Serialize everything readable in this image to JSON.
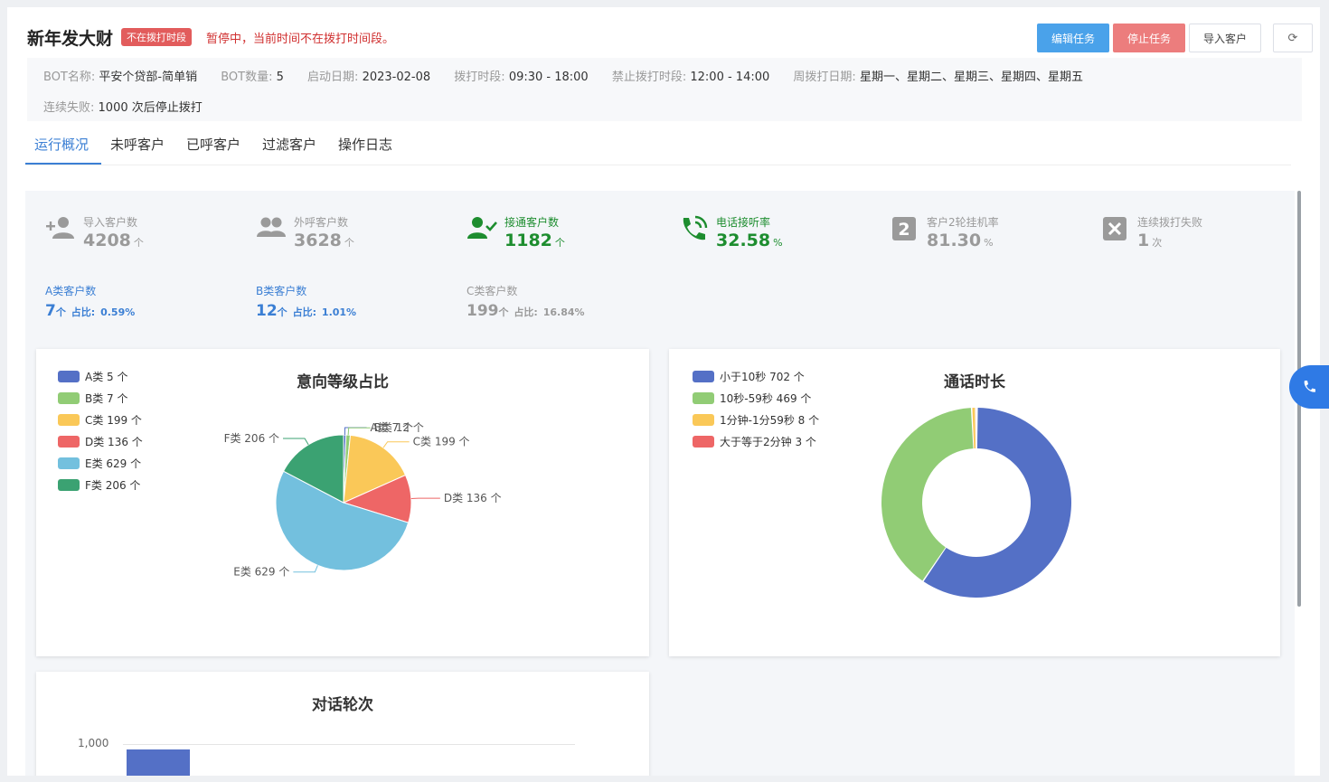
{
  "task": {
    "title": "新年发大财",
    "badge": "不在拨打时段",
    "status_message": "暂停中，当前时间不在拨打时间段。"
  },
  "buttons": {
    "edit": "编辑任务",
    "stop": "停止任务",
    "import": "导入客户",
    "refresh": "⟳"
  },
  "info": {
    "bot_name_label": "BOT名称:",
    "bot_name": "平安个贷部-简单销",
    "bot_count_label": "BOT数量:",
    "bot_count": "5",
    "start_date_label": "启动日期:",
    "start_date": "2023-02-08",
    "dial_period_label": "拨打时段:",
    "dial_period": "09:30 - 18:00",
    "forbid_period_label": "禁止拨打时段:",
    "forbid_period": "12:00 - 14:00",
    "weekly_label": "周拨打日期:",
    "weekly": "星期一、星期二、星期三、星期四、星期五",
    "fail_label": "连续失败:",
    "fail_value": "1000 次后停止拨打"
  },
  "tabs": [
    "运行概况",
    "未呼客户",
    "已呼客户",
    "过滤客户",
    "操作日志"
  ],
  "stats": [
    {
      "label": "导入客户数",
      "value": "4208",
      "unit": "个",
      "icon": "add-user-icon"
    },
    {
      "label": "外呼客户数",
      "value": "3628",
      "unit": "个",
      "icon": "users-icon"
    },
    {
      "label": "接通客户数",
      "value": "1182",
      "unit": "个",
      "icon": "user-check-icon"
    },
    {
      "label": "电话接听率",
      "value": "32.58",
      "unit": "%",
      "icon": "phone-ringing-icon"
    },
    {
      "label": "客户2轮挂机率",
      "value": "81.30",
      "unit": "%",
      "icon": "number-2-icon"
    },
    {
      "label": "连续拨打失败",
      "value": "1",
      "unit": "次",
      "icon": "x-box-icon"
    }
  ],
  "categories": [
    {
      "label": "A类客户数",
      "value": "7",
      "unit": "个",
      "ratio_label": "占比:",
      "ratio": "0.59%"
    },
    {
      "label": "B类客户数",
      "value": "12",
      "unit": "个",
      "ratio_label": "占比:",
      "ratio": "1.01%"
    },
    {
      "label": "C类客户数",
      "value": "199",
      "unit": "个",
      "ratio_label": "占比:",
      "ratio": "16.84%"
    }
  ],
  "colors": {
    "accent": "#3b7fd4",
    "green": "#1d8d2f",
    "stop": "#ec7d7d",
    "edit": "#4aa2ea"
  },
  "chart_data": [
    {
      "type": "pie",
      "title": "意向等级占比",
      "series": [
        {
          "name": "A类",
          "value": 7,
          "unit": "个",
          "color": "#5470c6"
        },
        {
          "name": "B类",
          "value": 12,
          "unit": "个",
          "color": "#91cc75"
        },
        {
          "name": "C类",
          "value": 199,
          "unit": "个",
          "color": "#fac858"
        },
        {
          "name": "D类",
          "value": 136,
          "unit": "个",
          "color": "#ee6666"
        },
        {
          "name": "E类",
          "value": 629,
          "unit": "个",
          "color": "#73c0de"
        },
        {
          "name": "F类",
          "value": 206,
          "unit": "个",
          "color": "#3ba272"
        }
      ],
      "legend_values": [
        5,
        7,
        199,
        136,
        629,
        206
      ],
      "legend": "top-left"
    },
    {
      "type": "pie",
      "title": "通话时长",
      "donut": true,
      "series": [
        {
          "name": "小于10秒",
          "value": 702,
          "unit": "个",
          "color": "#5470c6"
        },
        {
          "name": "10秒-59秒",
          "value": 469,
          "unit": "个",
          "color": "#91cc75"
        },
        {
          "name": "1分钟-1分59秒",
          "value": 8,
          "unit": "个",
          "color": "#fac858"
        },
        {
          "name": "大于等于2分钟",
          "value": 3,
          "unit": "个",
          "color": "#ee6666"
        }
      ],
      "legend": "top-left"
    },
    {
      "type": "bar",
      "title": "对话轮次",
      "y_ticks": [
        "1,000"
      ]
    }
  ],
  "fab": {
    "icon": "phone-icon"
  }
}
